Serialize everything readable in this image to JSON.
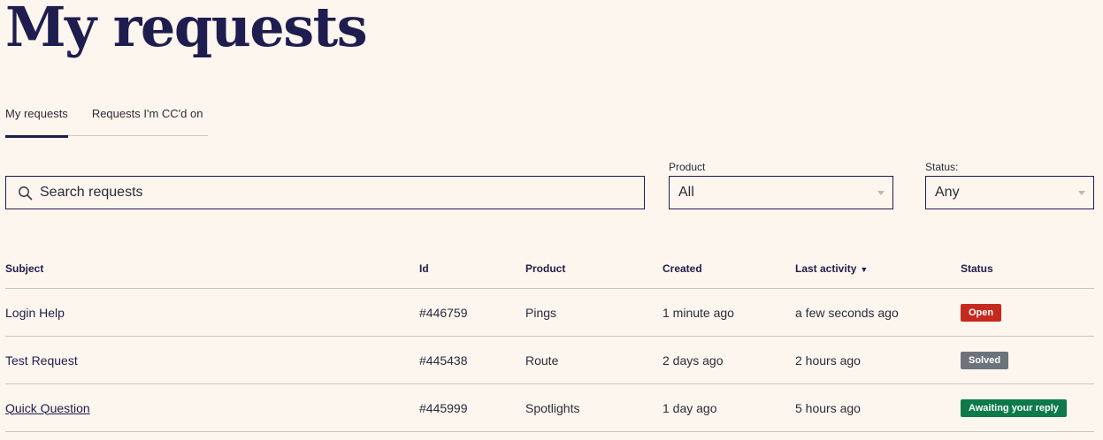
{
  "page": {
    "title": "My requests"
  },
  "tabs": [
    {
      "label": "My requests",
      "active": true
    },
    {
      "label": "Requests I'm CC'd on",
      "active": false
    }
  ],
  "search": {
    "placeholder": "Search requests",
    "value": ""
  },
  "filters": {
    "product": {
      "label": "Product",
      "value": "All"
    },
    "status": {
      "label": "Status:",
      "value": "Any"
    }
  },
  "table": {
    "columns": [
      "Subject",
      "Id",
      "Product",
      "Created",
      "Last activity",
      "Status"
    ],
    "rows": [
      {
        "subject": "Login Help",
        "id": "#446759",
        "product": "Pings",
        "created": "1 minute ago",
        "last_activity": "a few seconds ago",
        "status": "Open",
        "link": false
      },
      {
        "subject": "Test Request",
        "id": "#445438",
        "product": "Route",
        "created": "2 days ago",
        "last_activity": "2 hours ago",
        "status": "Solved",
        "link": false
      },
      {
        "subject": "Quick Question",
        "id": "#445999",
        "product": "Spotlights",
        "created": "1 day ago",
        "last_activity": "5 hours ago",
        "status": "Awaiting your reply",
        "link": true
      }
    ]
  },
  "colors": {
    "status_open": "#c42a1d",
    "status_solved": "#6c737b",
    "status_awaiting": "#0c7a4b",
    "brand": "#1f1c4f",
    "background": "#fdf6ee"
  },
  "icons": {
    "search": "search-icon",
    "sort": "sort-desc-icon",
    "dropdown": "chevron-down-icon"
  }
}
